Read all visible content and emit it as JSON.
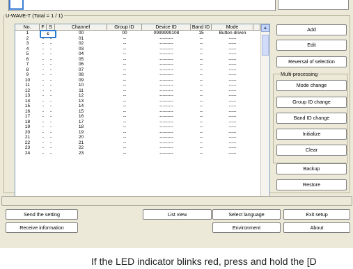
{
  "group": {
    "title": "U-WAVE-T (Total = 1 / 1)",
    "columns": [
      "No.",
      "F",
      "S",
      "Channel",
      "Group ID",
      "Device ID",
      "Band ID",
      "Mode"
    ],
    "rows": [
      [
        "1",
        "",
        "",
        "00",
        "00",
        "0999999108",
        "15",
        "Button driven"
      ],
      [
        "2",
        "-",
        "-",
        "01",
        "--",
        "---------",
        "--",
        "-----"
      ],
      [
        "3",
        "-",
        "-",
        "02",
        "--",
        "---------",
        "--",
        "-----"
      ],
      [
        "4",
        "-",
        "-",
        "03",
        "--",
        "---------",
        "--",
        "-----"
      ],
      [
        "5",
        "-",
        "-",
        "04",
        "--",
        "---------",
        "--",
        "-----"
      ],
      [
        "6",
        "-",
        "-",
        "05",
        "--",
        "---------",
        "--",
        "-----"
      ],
      [
        "7",
        "-",
        "-",
        "06",
        "--",
        "---------",
        "--",
        "-----"
      ],
      [
        "8",
        "-",
        "-",
        "07",
        "--",
        "---------",
        "--",
        "-----"
      ],
      [
        "9",
        "-",
        "-",
        "08",
        "--",
        "---------",
        "--",
        "-----"
      ],
      [
        "10",
        "-",
        "-",
        "09",
        "--",
        "---------",
        "--",
        "-----"
      ],
      [
        "11",
        "-",
        "-",
        "10",
        "--",
        "---------",
        "--",
        "-----"
      ],
      [
        "12",
        "-",
        "-",
        "11",
        "--",
        "---------",
        "--",
        "-----"
      ],
      [
        "13",
        "-",
        "-",
        "12",
        "--",
        "---------",
        "--",
        "-----"
      ],
      [
        "14",
        "-",
        "-",
        "13",
        "--",
        "---------",
        "--",
        "-----"
      ],
      [
        "15",
        "-",
        "-",
        "14",
        "--",
        "---------",
        "--",
        "-----"
      ],
      [
        "16",
        "-",
        "-",
        "15",
        "--",
        "---------",
        "--",
        "-----"
      ],
      [
        "17",
        "-",
        "-",
        "16",
        "--",
        "---------",
        "--",
        "-----"
      ],
      [
        "18",
        "-",
        "-",
        "17",
        "--",
        "---------",
        "--",
        "-----"
      ],
      [
        "19",
        "-",
        "-",
        "18",
        "--",
        "---------",
        "--",
        "-----"
      ],
      [
        "20",
        "-",
        "-",
        "19",
        "--",
        "---------",
        "--",
        "-----"
      ],
      [
        "21",
        "-",
        "-",
        "20",
        "--",
        "---------",
        "--",
        "-----"
      ],
      [
        "22",
        "-",
        "-",
        "21",
        "--",
        "---------",
        "--",
        "-----"
      ],
      [
        "23",
        "-",
        "-",
        "22",
        "--",
        "---------",
        "--",
        "-----"
      ],
      [
        "24",
        "-",
        "-",
        "23",
        "--",
        "---------",
        "--",
        "-----"
      ]
    ],
    "selected_cell": "c"
  },
  "right_buttons": {
    "add": "Add",
    "edit": "Edit",
    "reversal": "Reversal of selection",
    "multi_title": "Multi-processing",
    "mode_change": "Mode change",
    "group_change": "Group ID change",
    "band_change": "Band ID change",
    "initialize": "Initialize",
    "clear": "Clear",
    "backup": "Backup",
    "restore": "Restore"
  },
  "bottom_buttons": {
    "send": "Send the setting",
    "receive": "Receive information",
    "list_view": "List view",
    "select_language": "Select language",
    "environment": "Environment",
    "exit_setup": "Exit setup",
    "about": "About"
  },
  "footer": "If the LED indicator blinks red, press and hold the [D"
}
